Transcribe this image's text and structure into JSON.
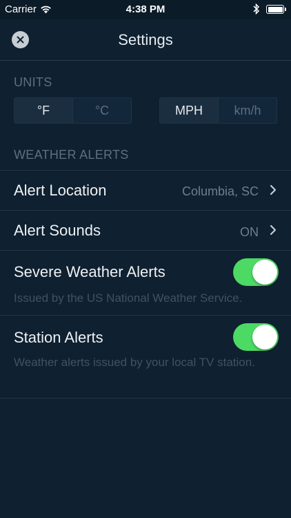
{
  "status_bar": {
    "carrier": "Carrier",
    "time": "4:38 PM"
  },
  "nav": {
    "title": "Settings",
    "close_icon": "close-icon"
  },
  "units": {
    "header": "UNITS",
    "temperature": {
      "options": [
        "°F",
        "°C"
      ],
      "selected": "°F"
    },
    "speed": {
      "options": [
        "MPH",
        "km/h"
      ],
      "selected": "MPH"
    }
  },
  "alerts": {
    "header": "WEATHER ALERTS",
    "location": {
      "label": "Alert Location",
      "value": "Columbia, SC"
    },
    "sounds": {
      "label": "Alert Sounds",
      "value": "ON"
    },
    "severe": {
      "label": "Severe Weather Alerts",
      "description": "Issued by the US National Weather Service.",
      "enabled": true
    },
    "station": {
      "label": "Station Alerts",
      "description": "Weather alerts issued by your local TV station.",
      "enabled": true
    }
  },
  "colors": {
    "background": "#0f2030",
    "toggle_on": "#4cd964",
    "muted_text": "#5d6f80"
  }
}
